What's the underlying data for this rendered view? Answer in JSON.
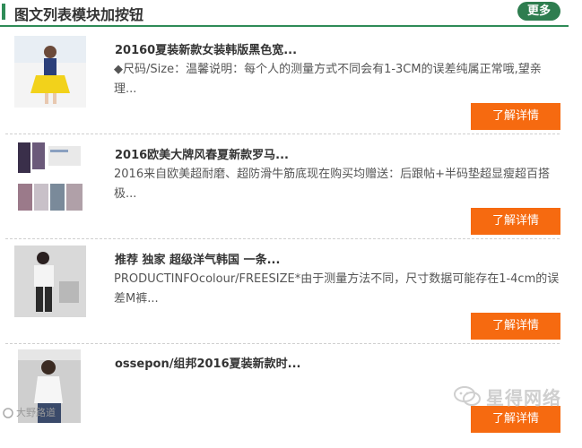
{
  "header": {
    "title": "图文列表模块加按钮",
    "more_label": "更多"
  },
  "items": [
    {
      "title": "20160夏装新款女装韩版黑色宽...",
      "desc": "◆尺码/Size：温馨说明：每个人的测量方式不同会有1-3CM的误差纯属正常哦,望亲理...",
      "button": "了解详情"
    },
    {
      "title": "2016欧美大牌风春夏新款罗马...",
      "desc": "2016来自欧美超耐磨、超防滑牛筋底现在购买均赠送：后跟帖+半码垫超显瘦超百搭极...",
      "button": "了解详情"
    },
    {
      "title": "推荐 独家 超级洋气韩国 一条...",
      "desc": "PRODUCTINFOcolour/FREESIZE*由于测量方法不同，尺寸数据可能存在1-4cm的误差M裤...",
      "button": "了解详情"
    },
    {
      "title": "ossepon/组邦2016夏装新款时...",
      "desc": "",
      "button": "了解详情"
    }
  ],
  "watermark": {
    "text": "星得网络",
    "icon": "wechat-icon"
  },
  "corner": {
    "text": "大野路道"
  }
}
